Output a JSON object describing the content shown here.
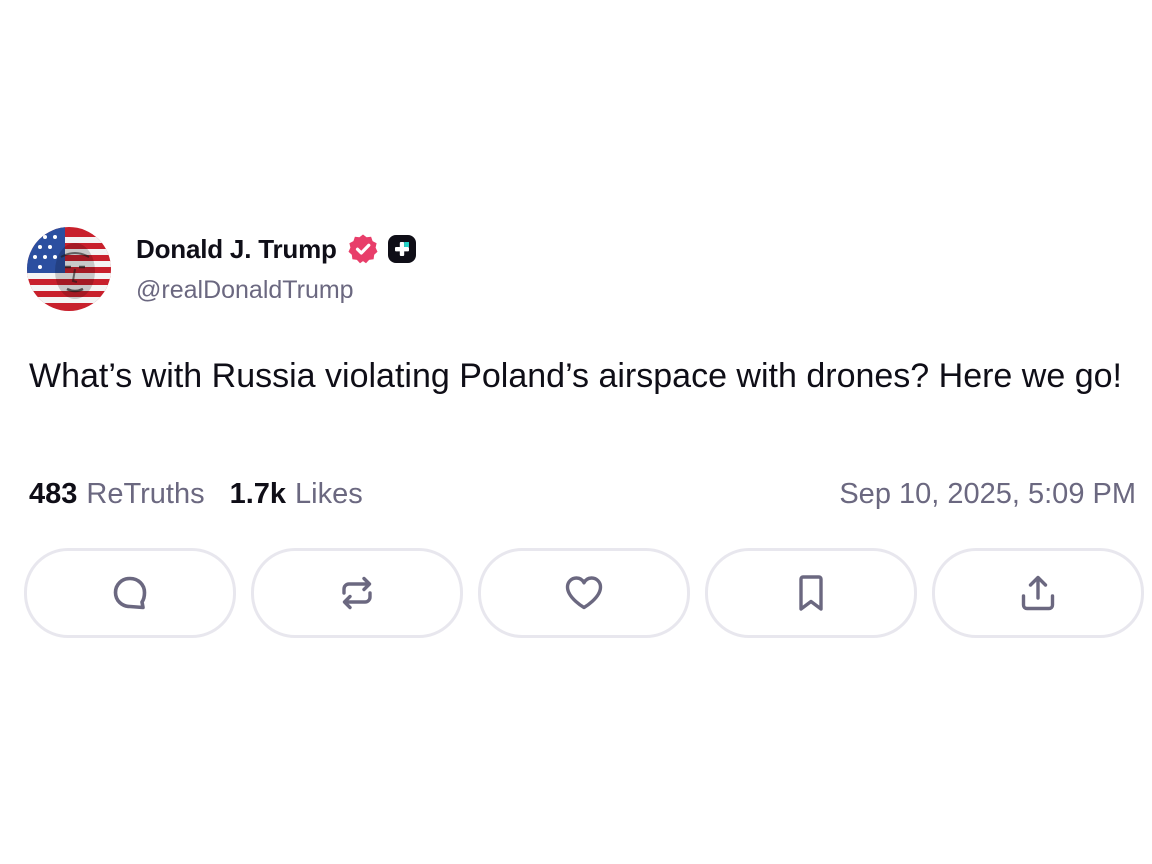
{
  "post": {
    "author": {
      "display_name": "Donald J. Trump",
      "handle": "@realDonaldTrump",
      "avatar_icon": "flag-face-avatar",
      "verified_icon": "verified-badge-icon",
      "verified_color": "#e83e6a",
      "badge_icon": "plus-badge-icon"
    },
    "text": "What’s with Russia violating Poland’s airspace with drones? Here we go!",
    "stats": {
      "retruths_count": "483",
      "retruths_label": "ReTruths",
      "likes_count": "1.7k",
      "likes_label": "Likes"
    },
    "timestamp": "Sep 10, 2025, 5:09 PM"
  },
  "actions": [
    {
      "name": "reply",
      "icon": "comment-bubble-icon"
    },
    {
      "name": "retruth",
      "icon": "repost-arrows-icon"
    },
    {
      "name": "like",
      "icon": "heart-icon"
    },
    {
      "name": "bookmark",
      "icon": "bookmark-icon"
    },
    {
      "name": "share",
      "icon": "share-upload-icon"
    }
  ],
  "colors": {
    "text_primary": "#0f0e17",
    "text_secondary": "#6b6880",
    "button_border": "#e8e7ee",
    "icon_stroke": "#6b6880"
  }
}
